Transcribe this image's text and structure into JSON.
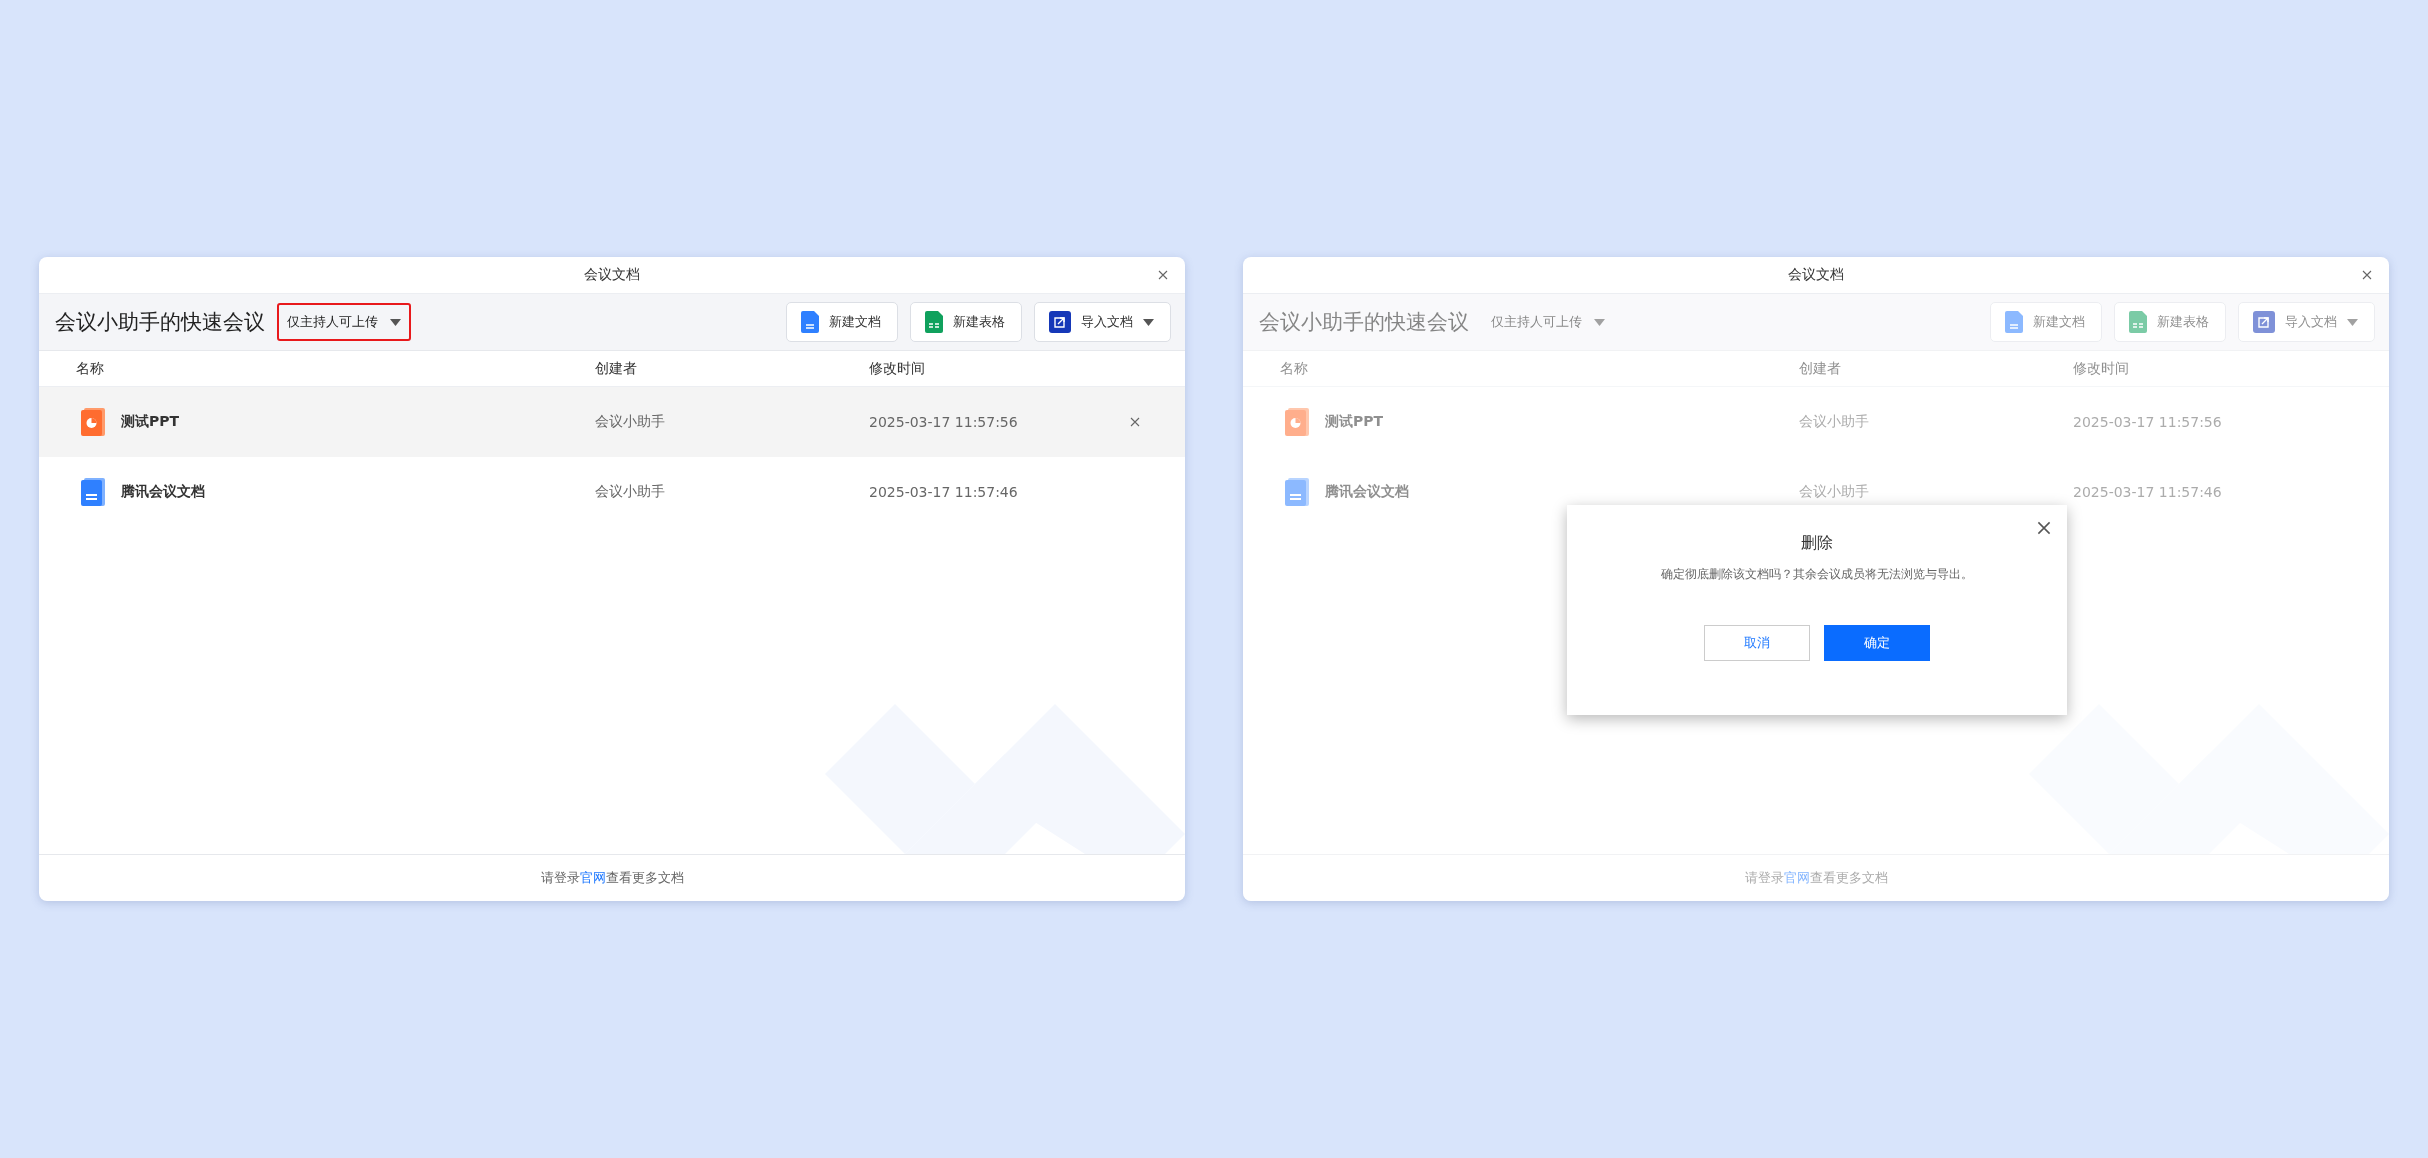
{
  "windows": [
    {
      "title": "会议文档",
      "meeting_title": "会议小助手的快速会议",
      "permission": {
        "label": "仅主持人可上传",
        "highlighted": true
      },
      "buttons": [
        {
          "label": "新建文档",
          "kind": "doc"
        },
        {
          "label": "新建表格",
          "kind": "sheet"
        },
        {
          "label": "导入文档",
          "kind": "import"
        }
      ],
      "columns": [
        "名称",
        "创建者",
        "修改时间"
      ],
      "rows": [
        {
          "kind": "ppt",
          "name": "测试PPT",
          "creator": "会议小助手",
          "modified": "2025-03-17 11:57:56",
          "hovered": true
        },
        {
          "kind": "doc",
          "name": "腾讯会议文档",
          "creator": "会议小助手",
          "modified": "2025-03-17 11:57:46",
          "hovered": false
        }
      ],
      "footer": {
        "before": "请登录",
        "link": "官网",
        "after": "查看更多文档"
      },
      "dimmed": false
    },
    {
      "title": "会议文档",
      "meeting_title": "会议小助手的快速会议",
      "permission": {
        "label": "仅主持人可上传",
        "highlighted": false
      },
      "buttons": [
        {
          "label": "新建文档",
          "kind": "doc"
        },
        {
          "label": "新建表格",
          "kind": "sheet"
        },
        {
          "label": "导入文档",
          "kind": "import"
        }
      ],
      "columns": [
        "名称",
        "创建者",
        "修改时间"
      ],
      "rows": [
        {
          "kind": "ppt",
          "name": "测试PPT",
          "creator": "会议小助手",
          "modified": "2025-03-17 11:57:56",
          "hovered": false
        },
        {
          "kind": "doc",
          "name": "腾讯会议文档",
          "creator": "会议小助手",
          "modified": "2025-03-17 11:57:46",
          "hovered": false
        }
      ],
      "footer": {
        "before": "请登录",
        "link": "官网",
        "after": "查看更多文档"
      },
      "dimmed": true,
      "dialog": {
        "title": "删除",
        "message": "确定彻底删除该文档吗？其余会议成员将无法浏览与导出。",
        "buttons": [
          {
            "label": "取消",
            "kind": "secondary"
          },
          {
            "label": "确定",
            "kind": "primary"
          }
        ]
      }
    }
  ]
}
